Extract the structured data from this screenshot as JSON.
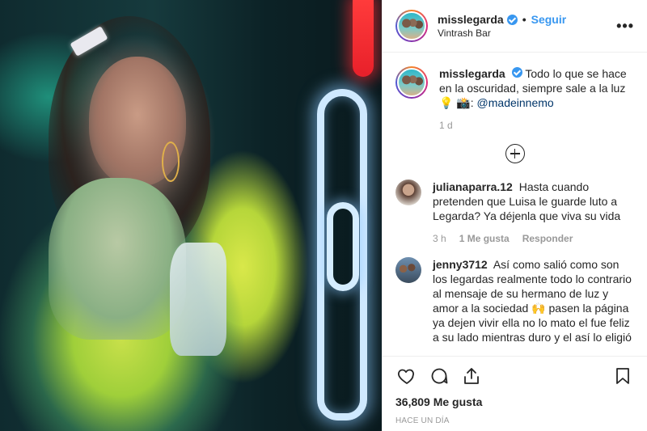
{
  "header": {
    "username": "misslegarda",
    "follow_label": "Seguir",
    "location": "Vintrash Bar",
    "more_label": "•••"
  },
  "caption": {
    "username": "misslegarda",
    "text": "Todo lo que se hace en la oscuridad, siempre sale a la luz 💡",
    "credit_prefix": "📸: ",
    "credit_handle": "@madeinnemo",
    "age": "1 d"
  },
  "comments": [
    {
      "username": "julianaparra.12",
      "text": "Hasta cuando pretenden que Luisa le guarde luto a Legarda? Ya déjenla que viva su vida",
      "age": "3 h",
      "likes": "1 Me gusta",
      "reply_label": "Responder"
    },
    {
      "username": "jenny3712",
      "text": "Así como salió como son los legardas realmente todo lo contrario al mensaje de su hermano de luz y amor a la sociedad 🙌 pasen la página ya dejen vivir ella no lo mato el fue feliz a su lado mientras duro y el así lo eligió"
    }
  ],
  "footer": {
    "likes": "36,809 Me gusta",
    "time": "HACE UN DÍA"
  },
  "colors": {
    "link_blue": "#3897f0",
    "text": "#262626",
    "muted": "#999999"
  }
}
